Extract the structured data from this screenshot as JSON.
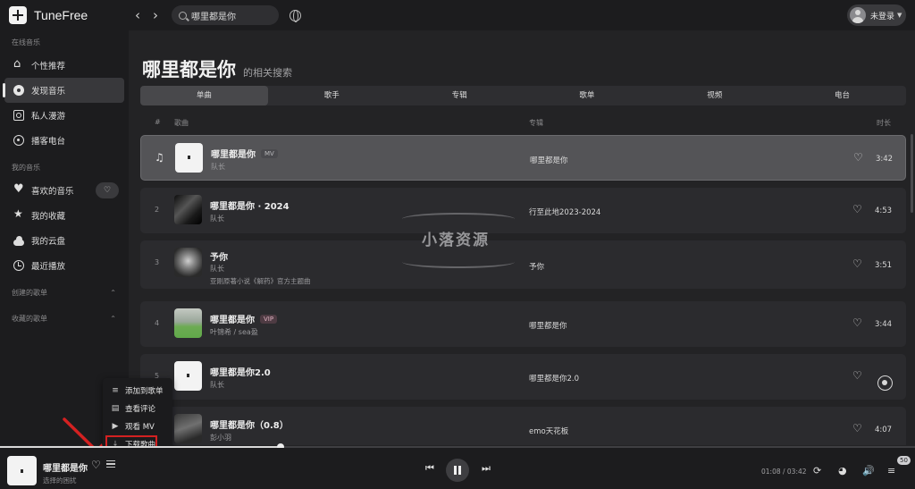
{
  "app": {
    "name": "TuneFree"
  },
  "search": {
    "value": "哪里都是你"
  },
  "account": {
    "login_label": "未登录"
  },
  "sidebar": {
    "online_title": "在线音乐",
    "online_items": [
      {
        "label": "个性推荐",
        "icon": "home-icon"
      },
      {
        "label": "发现音乐",
        "icon": "disc-icon",
        "active": true
      },
      {
        "label": "私人漫游",
        "icon": "radio-icon"
      },
      {
        "label": "播客电台",
        "icon": "podcast-icon"
      }
    ],
    "mine_title": "我的音乐",
    "mine_items": [
      {
        "label": "喜欢的音乐",
        "icon": "heart-icon"
      },
      {
        "label": "我的收藏",
        "icon": "star-icon"
      },
      {
        "label": "我的云盘",
        "icon": "cloud-icon"
      },
      {
        "label": "最近播放",
        "icon": "history-icon"
      }
    ],
    "created_title": "创建的歌单",
    "collected_title": "收藏的歌单"
  },
  "results": {
    "query": "哪里都是你",
    "subtitle": "的相关搜索",
    "tabs": [
      "单曲",
      "歌手",
      "专辑",
      "歌单",
      "视频",
      "电台"
    ],
    "active_tab": "单曲",
    "columns": {
      "index": "#",
      "song": "歌曲",
      "album": "专辑",
      "duration": "时长"
    },
    "songs": [
      {
        "num": "",
        "title": "哪里都是你",
        "tag": "MV",
        "artist": "队长",
        "album": "哪里都是你",
        "duration": "3:42",
        "playing": true
      },
      {
        "num": "2",
        "title": "哪里都是你 · 2024",
        "tag": "",
        "artist": "队长",
        "album": "行至此地2023-2024",
        "duration": "4:53"
      },
      {
        "num": "3",
        "title": "予你",
        "tag": "",
        "artist": "队长",
        "note": "亚刚原著小说《解药》官方主题曲",
        "album": "予你",
        "duration": "3:51"
      },
      {
        "num": "4",
        "title": "哪里都是你",
        "tag": "VIP",
        "artist": "叶锦希 / sea盈",
        "album": "哪里都是你",
        "duration": "3:44"
      },
      {
        "num": "5",
        "title": "哪里都是你2.0",
        "tag": "",
        "artist": "队长",
        "album": "哪里都是你2.0",
        "duration": ""
      },
      {
        "num": "",
        "title": "哪里都是你（0.8）",
        "tag": "",
        "artist": "彭小羽",
        "album": "emo天花板",
        "duration": "4:07"
      }
    ]
  },
  "watermark": {
    "text": "小落资源"
  },
  "context_menu": {
    "items": [
      {
        "label": "添加到歌单",
        "icon": "add-to-playlist-icon"
      },
      {
        "label": "查看评论",
        "icon": "comment-icon"
      },
      {
        "label": "观看 MV",
        "icon": "video-icon"
      },
      {
        "label": "下载歌曲",
        "icon": "download-icon",
        "highlighted": true
      }
    ]
  },
  "player": {
    "title": "哪里都是你",
    "subtitle": "选择的困扰",
    "elapsed_time": "01:08 / 03:42",
    "progress_fraction": 0.307,
    "queue_count": "50"
  },
  "colors": {
    "background": "#232325",
    "sidebar": "#1c1c1e",
    "active_row": "#545457",
    "highlight_border": "#d32121"
  }
}
